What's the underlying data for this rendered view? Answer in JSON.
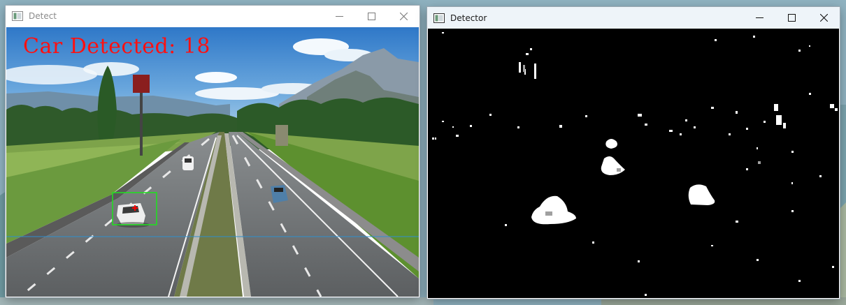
{
  "windows": {
    "detect": {
      "title": "Detect",
      "overlay_text": "Car Detected: 18",
      "colors": {
        "overlay_text": "#ff0000",
        "detection_box": "#22dd22",
        "counting_line": "#2e8fd0",
        "centroid_marker": "#ff0000"
      }
    },
    "detector": {
      "title": "Detector",
      "colors": {
        "background": "#000000",
        "foreground": "#ffffff"
      }
    }
  },
  "controls": {
    "minimize_icon": "minimize-icon",
    "maximize_icon": "maximize-icon",
    "close_icon": "close-icon"
  }
}
